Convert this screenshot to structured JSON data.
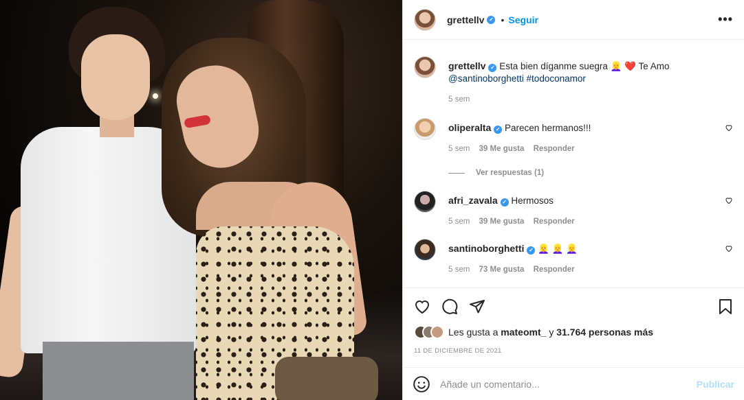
{
  "post": {
    "author": "grettellv",
    "follow_label": "Seguir",
    "more_label": "•••"
  },
  "caption": {
    "username": "grettellv",
    "text": "Esta bien díganme suegra 👱‍♀️ ❤️ Te Amo",
    "mention": "@santinoborghetti",
    "hashtag": "#todoconamor",
    "time": "5 sem"
  },
  "comments": [
    {
      "username": "oliperalta",
      "verified": true,
      "text": "Parecen hermanos!!!",
      "time": "5 sem",
      "likes": "39 Me gusta",
      "reply": "Responder"
    },
    {
      "username": "afri_zavala",
      "verified": true,
      "text": "Hermosos",
      "time": "5 sem",
      "likes": "39 Me gusta",
      "reply": "Responder"
    },
    {
      "username": "santinoborghetti",
      "verified": true,
      "text": "👱‍♀️ 👱‍♀️ 👱‍♀️",
      "time": "5 sem",
      "likes": "73 Me gusta",
      "reply": "Responder"
    }
  ],
  "replies_label": "Ver respuestas (1)",
  "likes": {
    "prefix": "Les gusta a",
    "user": "mateomt_",
    "connector": "y",
    "count": "31.764 personas más"
  },
  "date": "11 DE DICIEMBRE DE 2021",
  "add_comment": {
    "placeholder": "Añade un comentario...",
    "publish": "Publicar"
  },
  "icons": [
    "heart-icon",
    "comment-icon",
    "share-icon",
    "bookmark-icon",
    "emoji-icon",
    "more-icon"
  ],
  "colors": {
    "accent": "#0095f6",
    "verified": "#3897f0",
    "muted": "#8e8e8e",
    "publish_disabled": "#b2dffc"
  }
}
